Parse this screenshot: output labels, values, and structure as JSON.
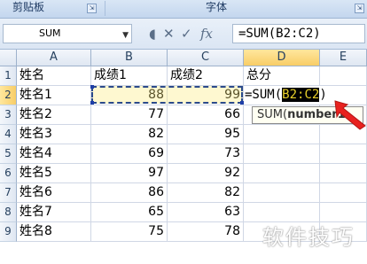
{
  "ribbon": {
    "group_clipboard": "剪贴板",
    "group_font": "字体"
  },
  "formula_bar": {
    "name_box": "SUM",
    "formula": "=SUM(B2:C2)"
  },
  "columns": [
    "A",
    "B",
    "C",
    "D",
    "E"
  ],
  "rows": [
    {
      "num": "1",
      "a": "姓名",
      "b": "成绩1",
      "c": "成绩2",
      "d": "总分"
    },
    {
      "num": "2",
      "a": "姓名1",
      "b": "88",
      "c": "99",
      "d": ""
    },
    {
      "num": "3",
      "a": "姓名2",
      "b": "77",
      "c": "66",
      "d": ""
    },
    {
      "num": "4",
      "a": "姓名3",
      "b": "82",
      "c": "95",
      "d": ""
    },
    {
      "num": "5",
      "a": "姓名4",
      "b": "69",
      "c": "73",
      "d": ""
    },
    {
      "num": "6",
      "a": "姓名5",
      "b": "97",
      "c": "92",
      "d": ""
    },
    {
      "num": "7",
      "a": "姓名6",
      "b": "86",
      "c": "82",
      "d": ""
    },
    {
      "num": "8",
      "a": "姓名7",
      "b": "65",
      "c": "63",
      "d": ""
    },
    {
      "num": "9",
      "a": "姓名8",
      "b": "75",
      "c": "78",
      "d": ""
    }
  ],
  "edit_cell": {
    "prefix": "=SUM(",
    "range": "B2:C2",
    "suffix": ")"
  },
  "tooltip": {
    "func": "SUM(",
    "arg": "number1"
  },
  "watermark": "软件技巧",
  "colors": {
    "range_border": "#2b4a8b",
    "header_selected": "#f8cd66",
    "arrow": "#e8221f"
  }
}
